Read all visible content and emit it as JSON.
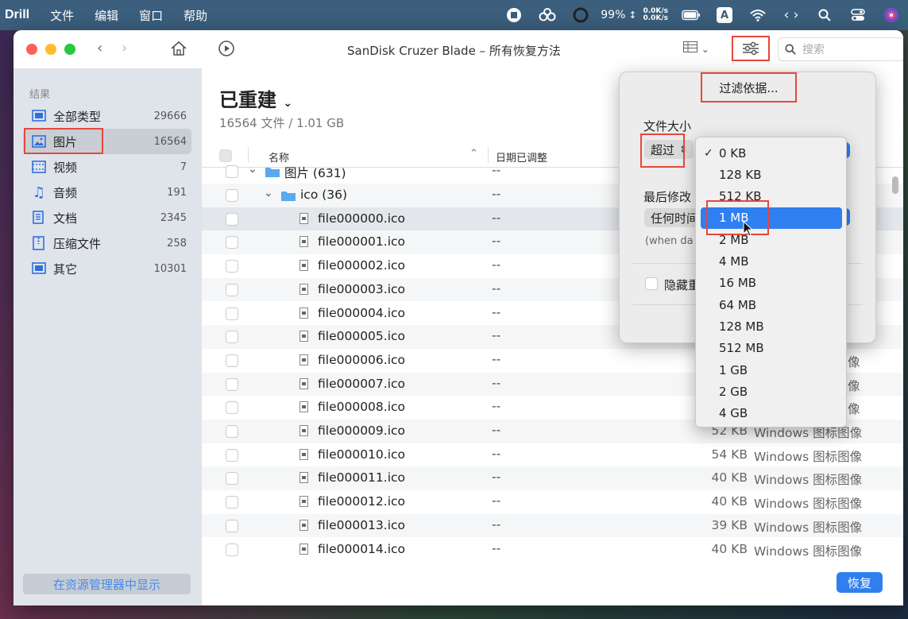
{
  "menubar": {
    "app": "Drill",
    "items": [
      "文件",
      "编辑",
      "窗口",
      "帮助"
    ],
    "battery": "99%",
    "net_up": "0.0K/s",
    "net_down": "0.0K/s",
    "input_label": "A"
  },
  "window": {
    "title": "SanDisk Cruzer Blade – 所有恢复方法",
    "search_placeholder": "搜索"
  },
  "sidebar": {
    "heading": "结果",
    "items": [
      {
        "label": "全部类型",
        "count": "29666"
      },
      {
        "label": "图片",
        "count": "16564"
      },
      {
        "label": "视频",
        "count": "7"
      },
      {
        "label": "音频",
        "count": "191"
      },
      {
        "label": "文档",
        "count": "2345"
      },
      {
        "label": "压缩文件",
        "count": "258"
      },
      {
        "label": "其它",
        "count": "10301"
      }
    ],
    "show_button": "在资源管理器中显示"
  },
  "main": {
    "title": "已重建",
    "subtitle": "16564 文件 / 1.01 GB",
    "columns": {
      "name": "名称",
      "date": "日期已调整"
    },
    "rows": [
      {
        "name": "图片 (631)",
        "date": "--",
        "size": "",
        "kind": ""
      },
      {
        "name": "ico (36)",
        "date": "--",
        "size": "",
        "kind": ""
      },
      {
        "name": "file000000.ico",
        "date": "--",
        "size": "",
        "kind": ""
      },
      {
        "name": "file000001.ico",
        "date": "--",
        "size": "",
        "kind": ""
      },
      {
        "name": "file000002.ico",
        "date": "--",
        "size": "",
        "kind": ""
      },
      {
        "name": "file000003.ico",
        "date": "--",
        "size": "",
        "kind": ""
      },
      {
        "name": "file000004.ico",
        "date": "--",
        "size": "",
        "kind": ""
      },
      {
        "name": "file000005.ico",
        "date": "--",
        "size": "",
        "kind": ""
      },
      {
        "name": "file000006.ico",
        "date": "--",
        "size": "",
        "kind": "像"
      },
      {
        "name": "file000007.ico",
        "date": "--",
        "size": "",
        "kind": "像"
      },
      {
        "name": "file000008.ico",
        "date": "--",
        "size": "",
        "kind": "像"
      },
      {
        "name": "file000009.ico",
        "date": "--",
        "size": "52 KB",
        "kind": "Windows 图标图像"
      },
      {
        "name": "file000010.ico",
        "date": "--",
        "size": "54 KB",
        "kind": "Windows 图标图像"
      },
      {
        "name": "file000011.ico",
        "date": "--",
        "size": "40 KB",
        "kind": "Windows 图标图像"
      },
      {
        "name": "file000012.ico",
        "date": "--",
        "size": "40 KB",
        "kind": "Windows 图标图像"
      },
      {
        "name": "file000013.ico",
        "date": "--",
        "size": "39 KB",
        "kind": "Windows 图标图像"
      },
      {
        "name": "file000014.ico",
        "date": "--",
        "size": "40 KB",
        "kind": "Windows 图标图像"
      }
    ],
    "recover_button": "恢复"
  },
  "filter_popover": {
    "title": "过滤依据...",
    "size_label": "文件大小",
    "size_operator": "超过",
    "date_label": "最后修改",
    "date_value": "任何时间",
    "date_note": "(when da",
    "hidden_label": "隐藏重"
  },
  "size_dropdown": {
    "options": [
      "0 KB",
      "128 KB",
      "512 KB",
      "1 MB",
      "2 MB",
      "4 MB",
      "16 MB",
      "64 MB",
      "128 MB",
      "512 MB",
      "1 GB",
      "2 GB",
      "4 GB"
    ],
    "checked": "0 KB",
    "highlighted": "1 MB"
  },
  "colors": {
    "accent": "#2f7ff0",
    "annotation": "#e8473c",
    "menubar": "#3b5f7d"
  }
}
